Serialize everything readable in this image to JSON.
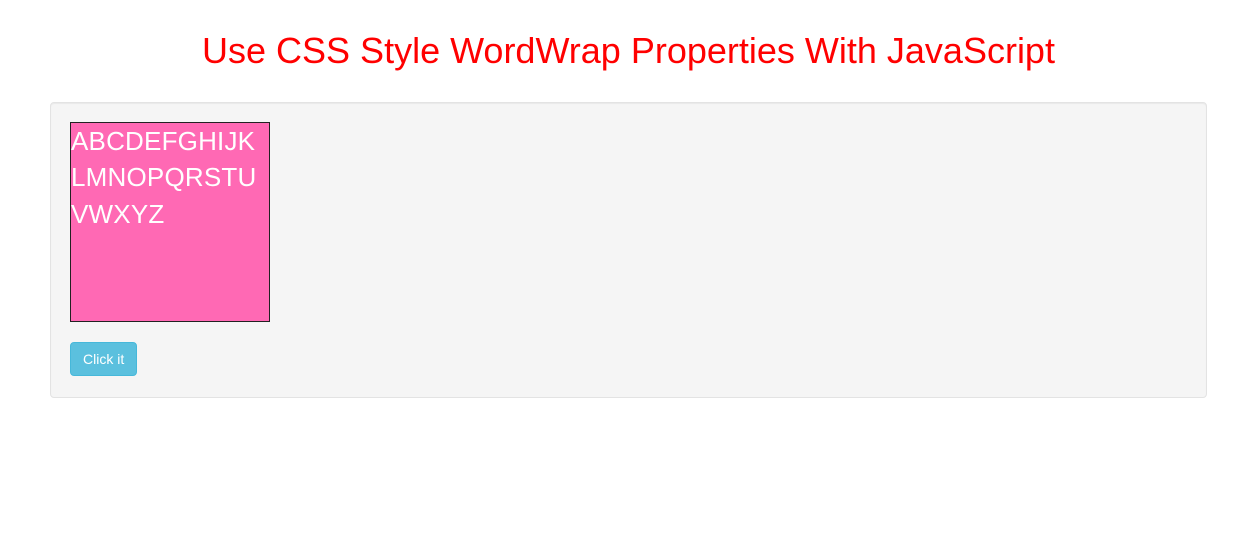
{
  "header": {
    "title": "Use CSS Style WordWrap Properties With JavaScript"
  },
  "demo": {
    "box_text": "ABCDEFGHIJKLMNOPQRSTUVWXYZ",
    "button_label": "Click it",
    "box_bg_color": "#ff69b4",
    "box_text_color": "#ffffff"
  }
}
